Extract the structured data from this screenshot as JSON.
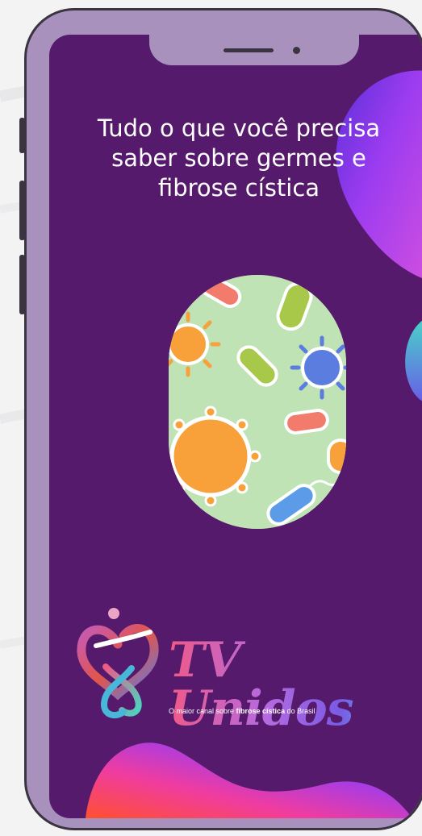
{
  "background_color": "#f3f3f4",
  "device": {
    "frame_color": "#a892bd",
    "border_color": "#3a3340",
    "screen_color": "#551a6b"
  },
  "screen": {
    "title": "Tudo o que você precisa\nsaber sobre germes e\nfibrose cística"
  },
  "logo": {
    "name": "TV Unidos",
    "tagline_prefix": "O maior canal sobre ",
    "tagline_highlight": "fibrose cística",
    "tagline_suffix": " do Brasil"
  }
}
